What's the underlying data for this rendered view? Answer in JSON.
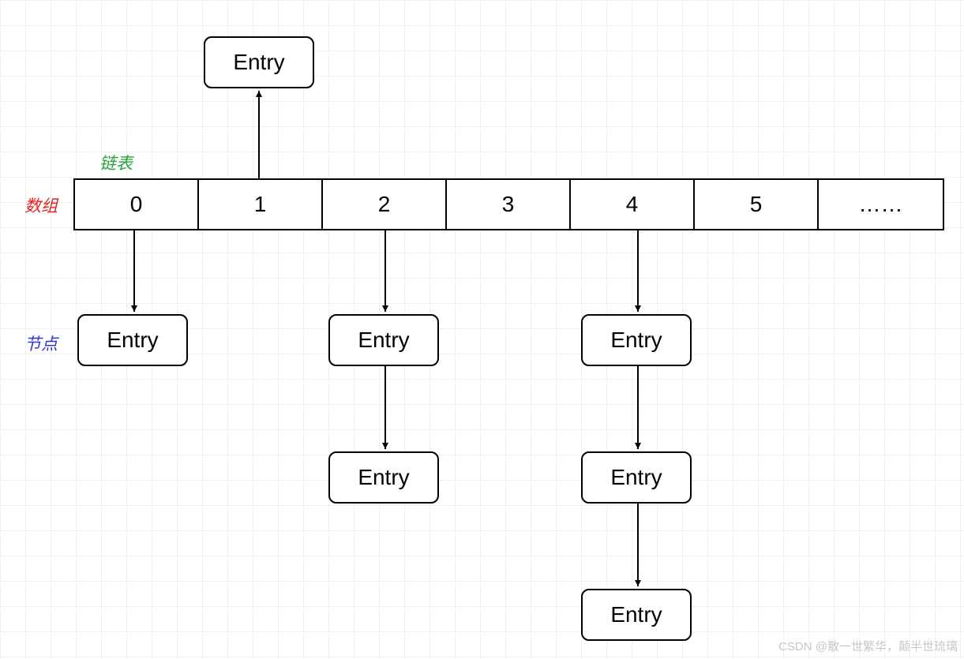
{
  "labels": {
    "linked_list": "链表",
    "array": "数组",
    "node": "节点"
  },
  "array_cells": [
    "0",
    "1",
    "2",
    "3",
    "4",
    "5",
    "……"
  ],
  "entries": {
    "top": "Entry",
    "c0_r0": "Entry",
    "c2_r0": "Entry",
    "c2_r1": "Entry",
    "c4_r0": "Entry",
    "c4_r1": "Entry",
    "c4_r2": "Entry"
  },
  "watermark": "CSDN @散一世繁华，颠半世琉璃"
}
